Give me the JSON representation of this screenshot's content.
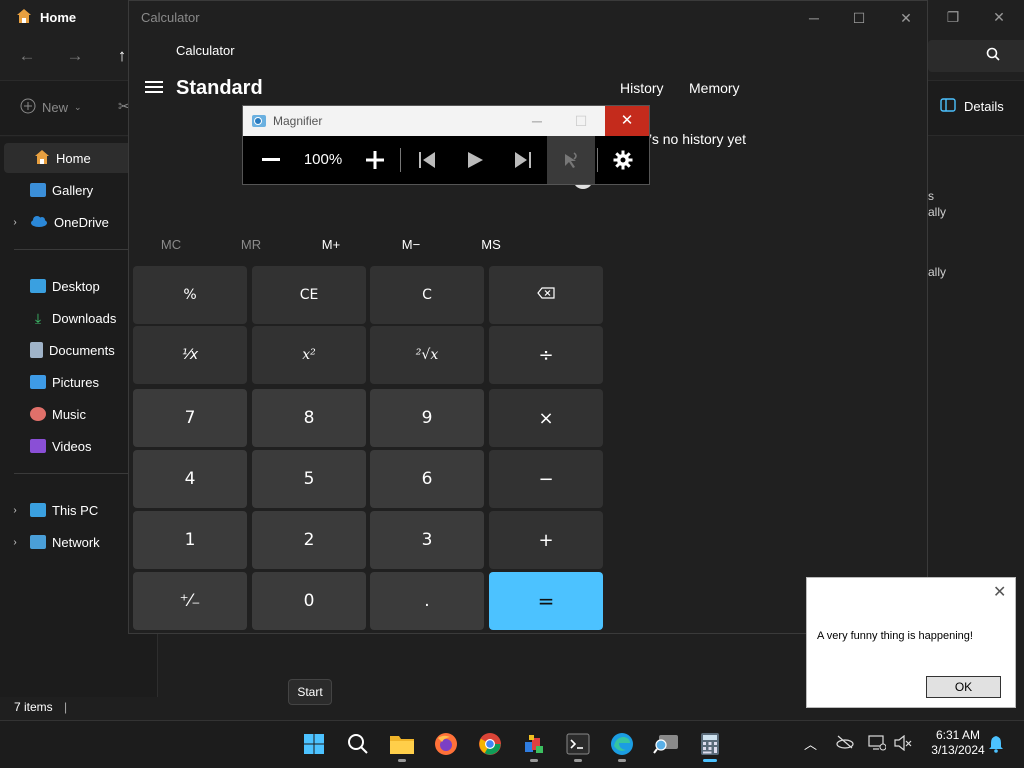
{
  "explorer": {
    "tab_title": "Home",
    "new_label": "New",
    "details_label": "Details",
    "sidebar": {
      "home": "Home",
      "gallery": "Gallery",
      "onedrive": "OneDrive",
      "desktop": "Desktop",
      "downloads": "Downloads",
      "documents": "Documents",
      "pictures": "Pictures",
      "music": "Music",
      "videos": "Videos",
      "thispc": "This PC",
      "network": "Network"
    },
    "status": "7 items",
    "snippets": [
      "s",
      "ally",
      "ally"
    ]
  },
  "calculator": {
    "window_title": "Calculator",
    "app_title": "Calculator",
    "mode": "Standard",
    "history_tab": "History",
    "memory_tab": "Memory",
    "history_empty": "’s no history yet",
    "memory_buttons": [
      "MC",
      "MR",
      "M+",
      "M−",
      "MS"
    ],
    "keys": {
      "percent": "%",
      "ce": "CE",
      "c": "C",
      "reciprocal": "⅟x",
      "square": "x²",
      "sqrt": "²√x",
      "divide": "÷",
      "k7": "7",
      "k8": "8",
      "k9": "9",
      "multiply": "×",
      "k4": "4",
      "k5": "5",
      "k6": "6",
      "minus": "−",
      "k1": "1",
      "k2": "2",
      "k3": "3",
      "plus": "+",
      "negate": "⁺⁄₋",
      "k0": "0",
      "decimal": ".",
      "equals": "="
    }
  },
  "magnifier": {
    "title": "Magnifier",
    "zoom": "100%"
  },
  "dialog": {
    "message": "A very funny thing is happening!",
    "ok_label": "OK"
  },
  "tooltip": {
    "start": "Start"
  },
  "taskbar": {
    "time": "6:31 AM",
    "date": "3/13/2024"
  },
  "colors": {
    "accent": "#4cc2ff",
    "close_red": "#c42b1c"
  }
}
